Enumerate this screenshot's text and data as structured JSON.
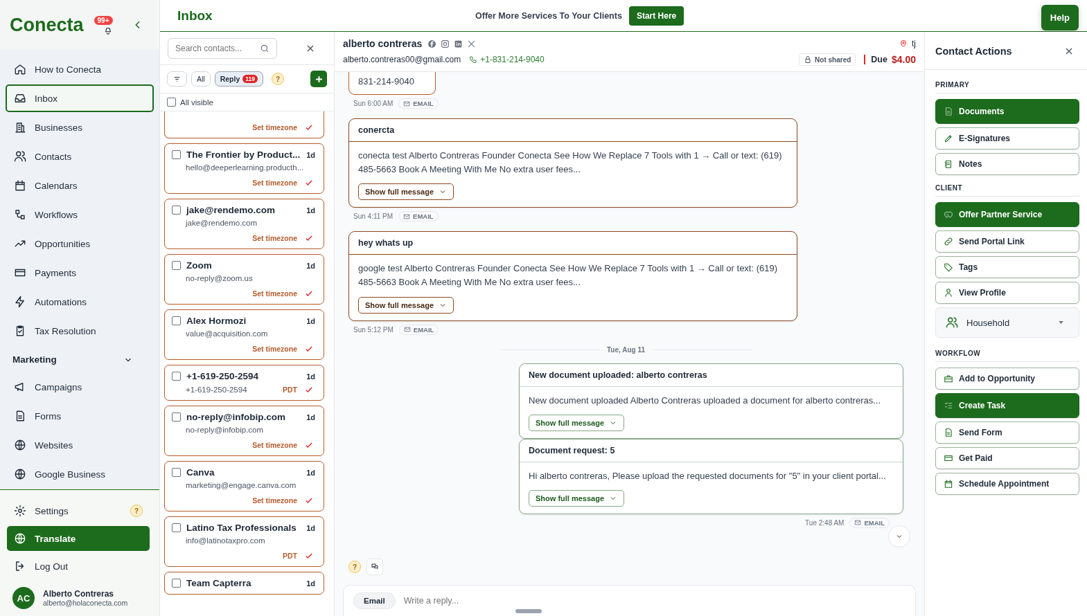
{
  "sidebar": {
    "logo": "Conecta",
    "notification_badge": "99+",
    "nav": [
      {
        "label": "How to Conecta",
        "selected": false
      },
      {
        "label": "Inbox",
        "selected": true
      },
      {
        "label": "Businesses",
        "selected": false
      },
      {
        "label": "Contacts",
        "selected": false
      },
      {
        "label": "Calendars",
        "selected": false
      },
      {
        "label": "Workflows",
        "selected": false
      },
      {
        "label": "Opportunities",
        "selected": false
      },
      {
        "label": "Payments",
        "selected": false
      },
      {
        "label": "Automations",
        "selected": false
      },
      {
        "label": "Tax Resolution",
        "selected": false
      }
    ],
    "section": {
      "label": "Marketing",
      "expanded": true,
      "items": [
        {
          "label": "Campaigns",
          "selected": false
        },
        {
          "label": "Forms",
          "selected": false
        },
        {
          "label": "Websites",
          "selected": false
        },
        {
          "label": "Google Business",
          "selected": false
        }
      ]
    },
    "bottom": [
      {
        "label": "Settings",
        "kind": "settings",
        "highlighted": false,
        "help": "?"
      },
      {
        "label": "Translate",
        "kind": "translate",
        "highlighted": true
      },
      {
        "label": "Log Out",
        "kind": "logout",
        "highlighted": false
      }
    ],
    "user": {
      "initials": "AC",
      "name": "Alberto Contreras",
      "email": "alberto@holaconecta.com"
    }
  },
  "topbar": {
    "title": "Inbox",
    "promo": "Offer More Services To Your Clients",
    "promo_button": "Start Here",
    "help_button": "Help"
  },
  "contacts": {
    "search_placeholder": "Search contacts...",
    "filters": [
      {
        "label": "All",
        "selected": false
      },
      {
        "label": "Reply",
        "count": "119",
        "selected": true
      }
    ],
    "help": "?",
    "select_all": {
      "label": "All visible",
      "checked": false
    },
    "items": [
      {
        "kind": "partial",
        "status": "Set timezone"
      },
      {
        "kind": "full",
        "name": "The Frontier by Product...",
        "email": "hello@deeperlearning.producth...",
        "time": "1d",
        "status": "Set timezone",
        "checked": false
      },
      {
        "kind": "full",
        "name": "jake@rendemo.com",
        "email": "jake@rendemo.com",
        "time": "1d",
        "status": "Set timezone",
        "checked": false
      },
      {
        "kind": "full",
        "name": "Zoom",
        "email": "no-reply@zoom.us",
        "time": "1d",
        "status": "Set timezone",
        "checked": false
      },
      {
        "kind": "full",
        "name": "Alex Hormozi",
        "email": "value@acquisition.com",
        "time": "1d",
        "status": "Set timezone",
        "checked": false
      },
      {
        "kind": "inline",
        "name": "+1-619-250-2594",
        "email": "+1-619-250-2594",
        "time": "1d",
        "status": "PDT",
        "checked": false
      },
      {
        "kind": "full",
        "name": "no-reply@infobip.com",
        "email": "no-reply@infobip.com",
        "time": "1d",
        "status": "Set timezone",
        "checked": false
      },
      {
        "kind": "full",
        "name": "Canva",
        "email": "marketing@engage.canva.com",
        "time": "1d",
        "status": "Set timezone",
        "checked": false
      },
      {
        "kind": "full",
        "name": "Latino Tax Professionals",
        "email": "info@latinotaxpro.com",
        "time": "1d",
        "status": "PDT",
        "checked": false
      },
      {
        "kind": "full",
        "name": "Team Capterra",
        "time": "1d",
        "checked": false
      }
    ]
  },
  "conversation": {
    "name": "alberto contreras",
    "email": "alberto.contreras00@gmail.com",
    "phone": "+1-831-214-9040",
    "location": "tj",
    "sharing": "Not shared",
    "due_label": "Due",
    "due_amount": "$4.00",
    "thread": [
      {
        "kind": "snippet",
        "body": "831-214-9040",
        "time": "Sun 6:00 AM",
        "channel": "EMAIL"
      },
      {
        "kind": "incoming",
        "subject": "conercta",
        "body": "conecta test Alberto Contreras Founder Conecta See How We Replace 7 Tools with 1 → Call or text: (619) 485-5663 Book A Meeting With Me No extra user fees...",
        "button": "Show full message",
        "time": "Sun 4:11 PM",
        "channel": "EMAIL"
      },
      {
        "kind": "incoming",
        "subject": "hey whats up",
        "body": "google test Alberto Contreras Founder Conecta See How We Replace 7 Tools with 1 → Call or text: (619) 485-5663 Book A Meeting With Me No extra user fees...",
        "button": "Show full message",
        "time": "Sun 5:12 PM",
        "channel": "EMAIL"
      },
      {
        "kind": "divider",
        "label": "Tue, Aug 11"
      },
      {
        "kind": "outgoing",
        "subject": "New document uploaded: alberto contreras",
        "body": "New document uploaded Alberto Contreras uploaded a document for alberto contreras...",
        "button": "Show full message"
      },
      {
        "kind": "outgoing",
        "subject": "Document request: 5",
        "body": "Hi alberto contreras, Please upload the requested documents for \"5\" in your client portal...",
        "button": "Show full message",
        "time": "Tue 2:48 AM",
        "channel": "EMAIL"
      }
    ],
    "help": "?",
    "composer": {
      "channel": "Email",
      "placeholder": "Write a reply..."
    }
  },
  "actions": {
    "title": "Contact Actions",
    "sections": [
      {
        "label": "PRIMARY",
        "items": [
          {
            "label": "Documents",
            "kind": "button",
            "highlighted": true
          },
          {
            "label": "E-Signatures",
            "kind": "button",
            "highlighted": false
          },
          {
            "label": "Notes",
            "kind": "button",
            "highlighted": false
          }
        ]
      },
      {
        "label": "CLIENT",
        "items": [
          {
            "label": "Offer Partner Service",
            "kind": "button",
            "highlighted": true
          },
          {
            "label": "Send Portal Link",
            "kind": "button",
            "highlighted": false
          },
          {
            "label": "Tags",
            "kind": "button",
            "highlighted": false
          },
          {
            "label": "View Profile",
            "kind": "button",
            "highlighted": false
          },
          {
            "label": "Household",
            "kind": "dropdown"
          }
        ]
      },
      {
        "label": "WORKFLOW",
        "items": [
          {
            "label": "Add to Opportunity",
            "kind": "button",
            "highlighted": false
          },
          {
            "label": "Create Task",
            "kind": "button",
            "highlighted": true
          },
          {
            "label": "Send Form",
            "kind": "button",
            "highlighted": false
          },
          {
            "label": "Get Paid",
            "kind": "button",
            "highlighted": false
          },
          {
            "label": "Schedule Appointment",
            "kind": "button",
            "highlighted": false
          }
        ]
      }
    ]
  }
}
